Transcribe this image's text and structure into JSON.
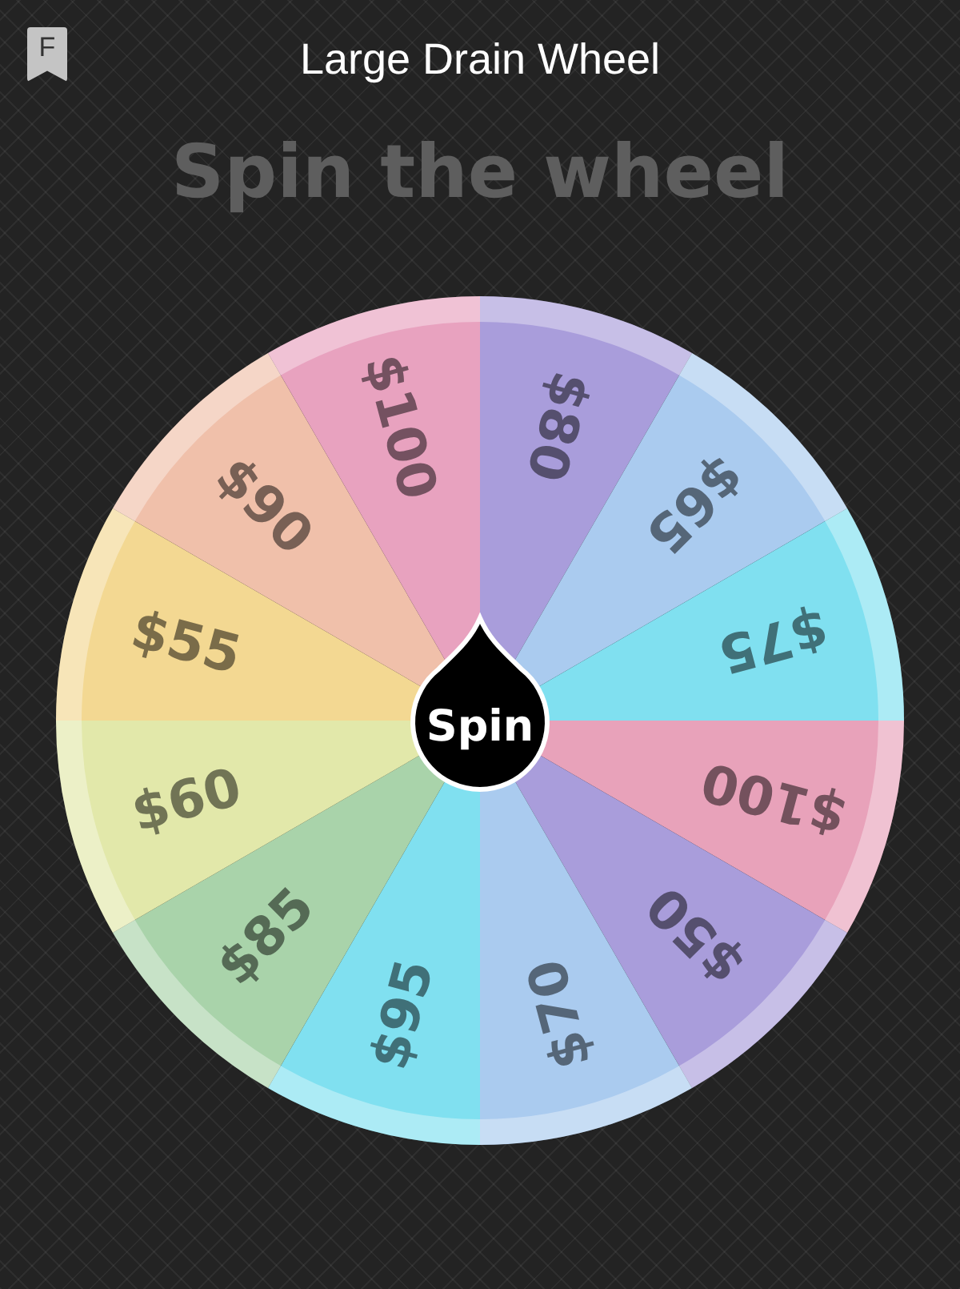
{
  "header": {
    "badge": "F",
    "title": "Large Drain Wheel"
  },
  "heading": "Spin the wheel",
  "wheel": {
    "segments": [
      {
        "label": "$80",
        "color": "#a99ddb"
      },
      {
        "label": "$65",
        "color": "#aacbef"
      },
      {
        "label": "$75",
        "color": "#80e0f0"
      },
      {
        "label": "$100",
        "color": "#e8a2ba"
      },
      {
        "label": "$50",
        "color": "#a99ddb"
      },
      {
        "label": "$70",
        "color": "#aacbef"
      },
      {
        "label": "$95",
        "color": "#80e0f0"
      },
      {
        "label": "$85",
        "color": "#a9d3aa"
      },
      {
        "label": "$60",
        "color": "#e2e8aa"
      },
      {
        "label": "$55",
        "color": "#f3d892"
      },
      {
        "label": "$90",
        "color": "#f0c0aa"
      },
      {
        "label": "$100",
        "color": "#e8a2bf"
      }
    ],
    "button": "Spin"
  }
}
